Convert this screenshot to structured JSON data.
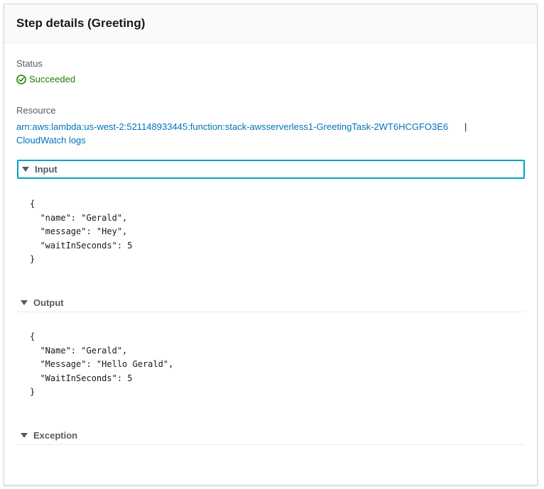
{
  "panel": {
    "title": "Step details (Greeting)"
  },
  "status": {
    "label": "Status",
    "value": "Succeeded",
    "icon": "success-check-icon",
    "color": "#1d8102"
  },
  "resource": {
    "label": "Resource",
    "arn": "arn:aws:lambda:us-west-2:521148933445:function:stack-awsserverless1-GreetingTask-2WT6HCGFO3E6",
    "separator": "|",
    "logs_link": "CloudWatch logs",
    "link_color": "#0073bb"
  },
  "input": {
    "title": "Input",
    "code": "{\n  \"name\": \"Gerald\",\n  \"message\": \"Hey\",\n  \"waitInSeconds\": 5\n}"
  },
  "output": {
    "title": "Output",
    "code": "{\n  \"Name\": \"Gerald\",\n  \"Message\": \"Hello Gerald\",\n  \"WaitInSeconds\": 5\n}"
  },
  "exception": {
    "title": "Exception"
  }
}
